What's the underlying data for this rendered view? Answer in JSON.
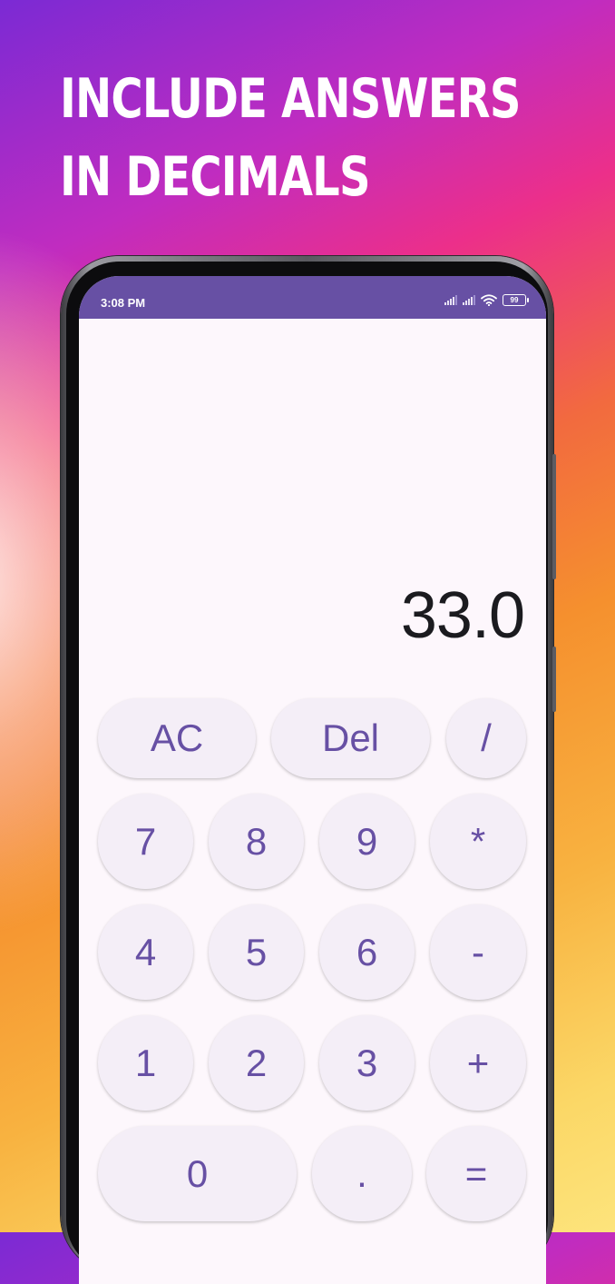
{
  "promo": {
    "line1": "INCLUDE ANSWERS",
    "line2": "IN DECIMALS"
  },
  "status_bar": {
    "time": "3:08 PM",
    "battery": "99",
    "icons": [
      "signal-icon",
      "signal-icon",
      "wifi-icon",
      "battery-icon"
    ]
  },
  "calculator": {
    "display_value": "33.0",
    "keys": {
      "ac": "AC",
      "del": "Del",
      "divide": "/",
      "seven": "7",
      "eight": "8",
      "nine": "9",
      "multiply": "*",
      "four": "4",
      "five": "5",
      "six": "6",
      "minus": "-",
      "one": "1",
      "two": "2",
      "three": "3",
      "plus": "+",
      "zero": "0",
      "decimal": ".",
      "equals": "="
    }
  },
  "colors": {
    "accent": "#6750a4",
    "key_background": "#f4eef7",
    "screen_background": "#fdf7fc",
    "display_text": "#1b1b1f"
  }
}
